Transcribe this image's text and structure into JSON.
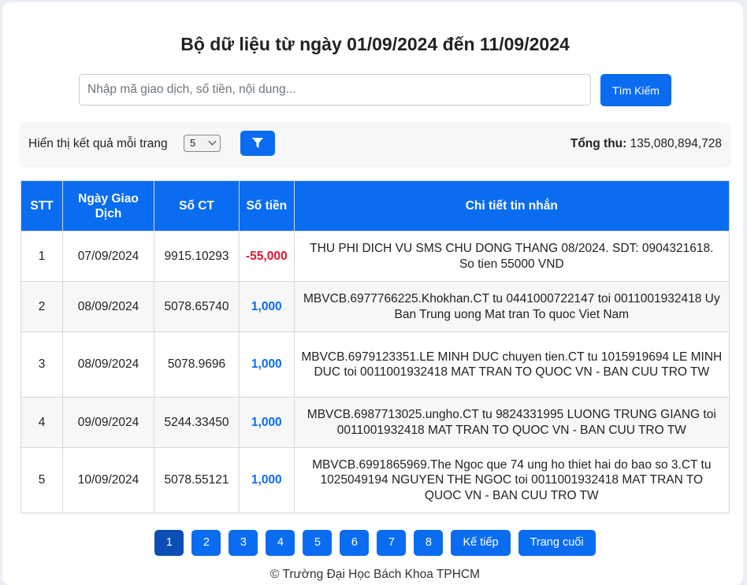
{
  "title": "Bộ dữ liệu từ ngày 01/09/2024 đến 11/09/2024",
  "search": {
    "placeholder": "Nhập mã giao dịch, số tiền, nội dung...",
    "value": "",
    "button_label": "Tìm Kiếm"
  },
  "toolbar": {
    "per_page_label": "Hiển thị kết quả mỗi trang",
    "per_page_value": "5",
    "filter_icon": "filter-icon",
    "total_label": "Tổng thu:",
    "total_value": "135,080,894,728"
  },
  "table": {
    "headers": [
      "STT",
      "Ngày Giao Dịch",
      "Số CT",
      "Số tiền",
      "Chi tiết tin nhắn"
    ],
    "rows": [
      {
        "stt": "1",
        "date": "07/09/2024",
        "ct": "9915.10293",
        "amount": "-55,000",
        "amount_color": "#e0142c",
        "detail": "THU PHI DICH VU SMS CHU DONG THANG 08/2024. SDT: 0904321618. So tien 55000 VND"
      },
      {
        "stt": "2",
        "date": "08/09/2024",
        "ct": "5078.65740",
        "amount": "1,000",
        "amount_color": "#0a6cf0",
        "detail": "MBVCB.6977766225.Khokhan.CT tu 0441000722147 toi 0011001932418 Uy Ban Trung uong Mat tran To quoc Viet Nam"
      },
      {
        "stt": "3",
        "date": "08/09/2024",
        "ct": "5078.9696",
        "amount": "1,000",
        "amount_color": "#0a6cf0",
        "detail": "MBVCB.6979123351.LE MINH DUC chuyen tien.CT tu 1015919694 LE MINH DUC toi 0011001932418 MAT TRAN TO QUOC VN - BAN CUU TRO TW"
      },
      {
        "stt": "4",
        "date": "09/09/2024",
        "ct": "5244.33450",
        "amount": "1,000",
        "amount_color": "#0a6cf0",
        "detail": "MBVCB.6987713025.ungho.CT tu 9824331995 LUONG TRUNG GIANG toi 0011001932418 MAT TRAN TO QUOC VN - BAN CUU TRO TW"
      },
      {
        "stt": "5",
        "date": "10/09/2024",
        "ct": "5078.55121",
        "amount": "1,000",
        "amount_color": "#0a6cf0",
        "detail": "MBVCB.6991865969.The Ngoc que 74 ung ho thiet hai do bao so 3.CT tu 1025049194 NGUYEN THE NGOC toi 0011001932418 MAT TRAN TO QUOC VN - BAN CUU TRO TW"
      }
    ]
  },
  "pagination": {
    "pages": [
      "1",
      "2",
      "3",
      "4",
      "5",
      "6",
      "7",
      "8"
    ],
    "current": "1",
    "next_label": "Kế tiếp",
    "last_label": "Trang cuối"
  },
  "footer": "© Trường Đại Học Bách Khoa TPHCM",
  "colors": {
    "accent": "#0a6cf0",
    "active_page": "#0a4fb5",
    "negative": "#e0142c"
  }
}
